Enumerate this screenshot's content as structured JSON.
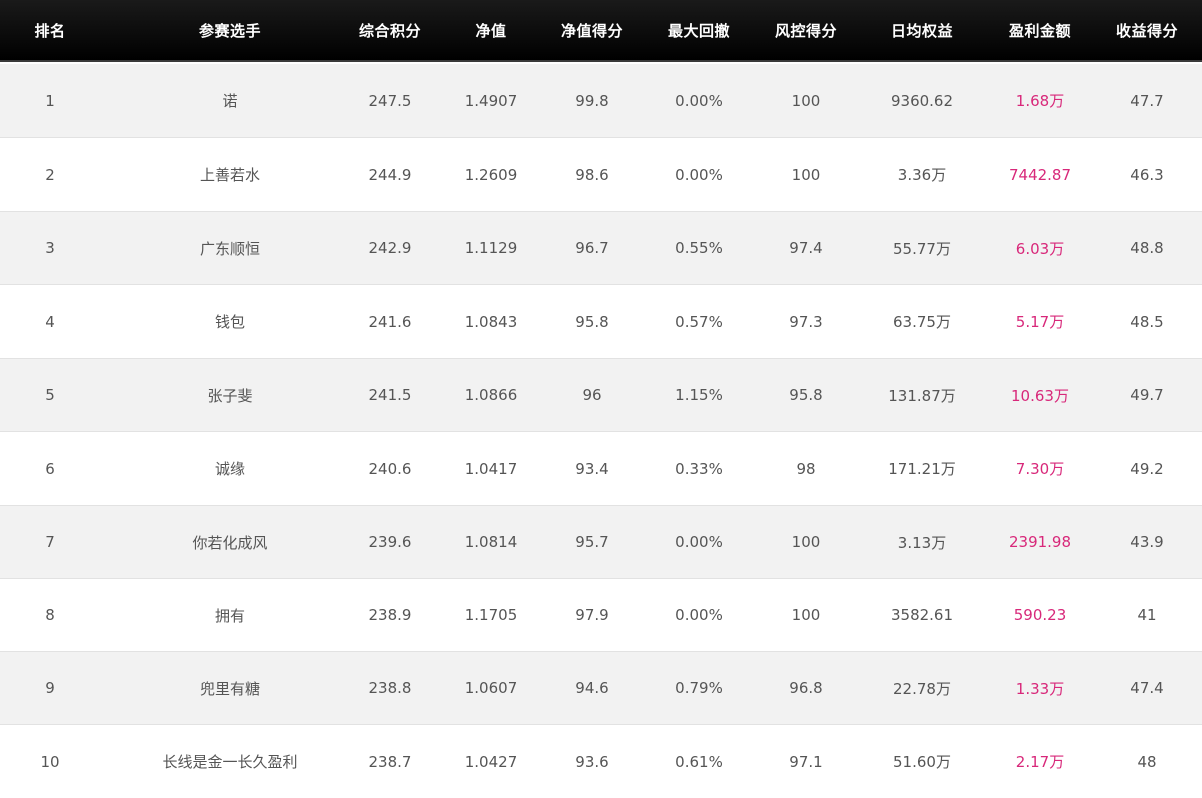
{
  "table": {
    "headers": [
      "排名",
      "参赛选手",
      "综合积分",
      "净值",
      "净值得分",
      "最大回撤",
      "风控得分",
      "日均权益",
      "盈利金额",
      "收益得分"
    ],
    "rows": [
      [
        "1",
        "诺",
        "247.5",
        "1.4907",
        "99.8",
        "0.00%",
        "100",
        "9360.62",
        "1.68万",
        "47.7"
      ],
      [
        "2",
        "上善若水",
        "244.9",
        "1.2609",
        "98.6",
        "0.00%",
        "100",
        "3.36万",
        "7442.87",
        "46.3"
      ],
      [
        "3",
        "广东顺恒",
        "242.9",
        "1.1129",
        "96.7",
        "0.55%",
        "97.4",
        "55.77万",
        "6.03万",
        "48.8"
      ],
      [
        "4",
        "钱包",
        "241.6",
        "1.0843",
        "95.8",
        "0.57%",
        "97.3",
        "63.75万",
        "5.17万",
        "48.5"
      ],
      [
        "5",
        "张子斐",
        "241.5",
        "1.0866",
        "96",
        "1.15%",
        "95.8",
        "131.87万",
        "10.63万",
        "49.7"
      ],
      [
        "6",
        "诚缘",
        "240.6",
        "1.0417",
        "93.4",
        "0.33%",
        "98",
        "171.21万",
        "7.30万",
        "49.2"
      ],
      [
        "7",
        "你若化成风",
        "239.6",
        "1.0814",
        "95.7",
        "0.00%",
        "100",
        "3.13万",
        "2391.98",
        "43.9"
      ],
      [
        "8",
        "拥有",
        "238.9",
        "1.1705",
        "97.9",
        "0.00%",
        "100",
        "3582.61",
        "590.23",
        "41"
      ],
      [
        "9",
        "兜里有糖",
        "238.8",
        "1.0607",
        "94.6",
        "0.79%",
        "96.8",
        "22.78万",
        "1.33万",
        "47.4"
      ],
      [
        "10",
        "长线是金一长久盈利",
        "238.7",
        "1.0427",
        "93.6",
        "0.61%",
        "97.1",
        "51.60万",
        "2.17万",
        "48"
      ]
    ]
  },
  "colors": {
    "header_bg": "#0a0a0a",
    "header_text": "#ffffff",
    "row_alt_bg": "#f2f2f2",
    "row_bg": "#ffffff",
    "text": "#555555",
    "profit_text": "#d8287a"
  }
}
